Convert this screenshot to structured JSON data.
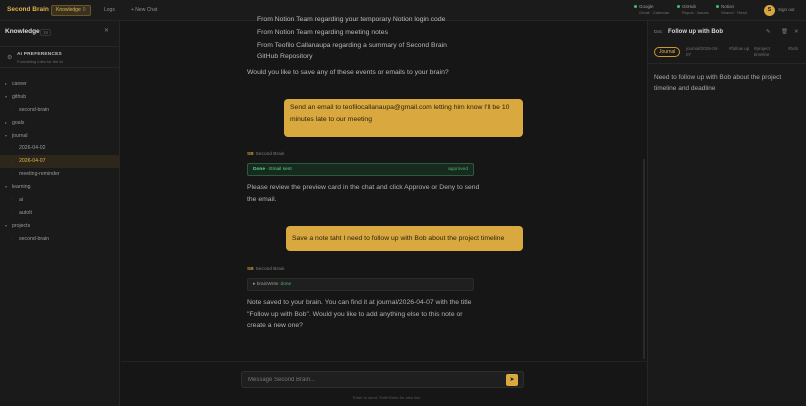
{
  "topbar": {
    "brand": "Second Brain",
    "knowledge_label": "Knowledge",
    "knowledge_count": "0",
    "logs_label": "Logs",
    "new_chat_label": "+ New Chat",
    "integrations": [
      {
        "name": "Google",
        "scopes": "Gmail · Calendar"
      },
      {
        "name": "GitHub",
        "scopes": "Repos · Issues"
      },
      {
        "name": "Notion",
        "scopes": "Search · Read"
      }
    ],
    "avatar_initial": "S",
    "sign_out_label": "Sign out",
    "status_color": "#3fbf6a",
    "accent_color": "#e0b24a"
  },
  "sidebar": {
    "title": "Knowledge",
    "count": "15",
    "close_icon": "close-icon",
    "prefs_title": "AI PREFERENCES",
    "prefs_subtitle": "Formatting rules for the AI",
    "tree": [
      {
        "label": "career",
        "level": 0,
        "expanded": false
      },
      {
        "label": "github",
        "level": 0,
        "expanded": true
      },
      {
        "label": "second-brain",
        "level": 1
      },
      {
        "label": "goals",
        "level": 0,
        "expanded": false
      },
      {
        "label": "journal",
        "level": 0,
        "expanded": true
      },
      {
        "label": "2026-04-02",
        "level": 1
      },
      {
        "label": "2026-04-07",
        "level": 1,
        "active": true
      },
      {
        "label": "meeting-reminder",
        "level": 1
      },
      {
        "label": "learning",
        "level": 0,
        "expanded": true
      },
      {
        "label": "ai",
        "level": 1
      },
      {
        "label": "autoIt",
        "level": 1
      },
      {
        "label": "projects",
        "level": 0,
        "expanded": true
      },
      {
        "label": "second-brain",
        "level": 1
      }
    ]
  },
  "chat": {
    "partial_lines": [
      "From Notion Team regarding your temporary Notion login code",
      "From Notion Team regarding meeting notes",
      "From Teofilo Callanaupa regarding a summary of Second Brain",
      "GitHub Repository"
    ],
    "question": "Would you like to save any of these events or emails to your brain?",
    "user_msg_1": "Send an email to teofilocallanaupa@gmail.com letting him know I'll be 10 minutes late to our meeting",
    "ai_name": "Second Brain",
    "ai_initials": "SB",
    "email_card_done": "Done",
    "email_card_label": "Email sent",
    "email_card_status": "approved",
    "ai_reply_1": "Please review the preview card in the chat and click Approve or Deny to send the email.",
    "user_msg_2": "Save a note taht I need to follow up with Bob about the project timeline",
    "tool_card_name": "brainWrite",
    "tool_card_status": "done",
    "ai_reply_2": "Note saved to your brain. You can find it at journal/2026-04-07 with the title \"Follow up with Bob\". Would you like to add anything else to this note or create a new one?",
    "input_placeholder": "Message Second Brain...",
    "send_icon": "send-icon",
    "hint": "Enter to send, Shift+Enter for new line"
  },
  "doc": {
    "prefix": "Doc",
    "title": "Follow up with Bob",
    "tag_journal": "Journal",
    "path": "journal/2026-04-07",
    "tags": [
      "#follow up",
      "#project timeline",
      "#bob"
    ],
    "body": "Need to follow up with Bob about the project timeline and deadline"
  }
}
